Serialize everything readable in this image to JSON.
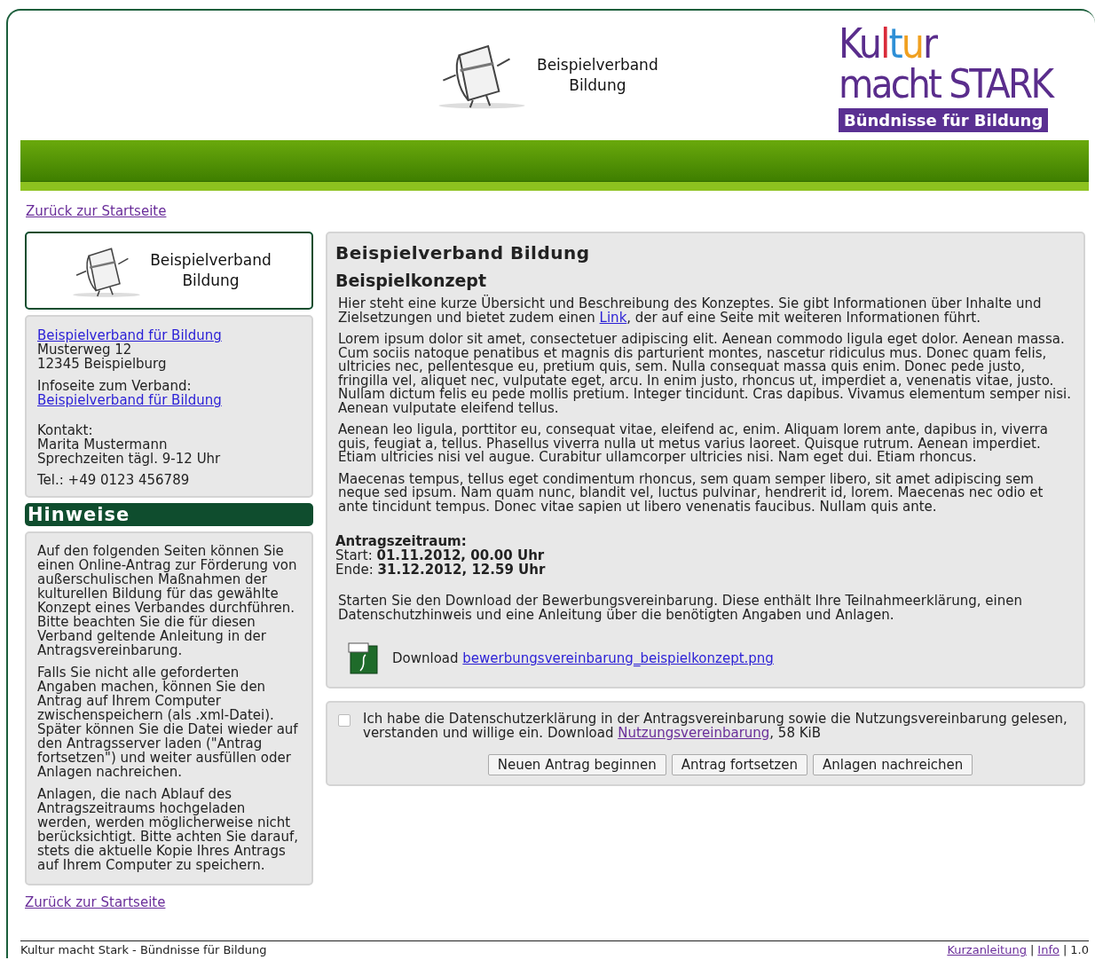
{
  "header": {
    "org_name": [
      "Beispielverband",
      "Bildung"
    ],
    "logo": {
      "word": "Kultur",
      "line2": "macht STARK",
      "banner": "Bündnisse für Bildung"
    }
  },
  "back_link_top": "Zurück zur Startseite",
  "sidebar": {
    "org_card": [
      "Beispielverband",
      "Bildung"
    ],
    "address": {
      "link": "Beispielverband für Bildung",
      "lines": [
        "Musterweg 12",
        "12345 Beispielburg"
      ],
      "info_label": "Infoseite zum Verband:",
      "info_link": "Beispielverband für Bildung",
      "contact": [
        "Kontakt:",
        "Marita Mustermann",
        "Sprechzeiten tägl. 9-12 Uhr"
      ],
      "phone": "Tel.: +49 0123 456789"
    },
    "notes_title": "Hinweise",
    "notes": [
      "Auf den folgenden Seiten können Sie einen Online-Antrag zur Förderung von außerschulischen Maßnahmen der kulturellen Bildung für das gewählte Konzept eines Verbandes durchführen. Bitte beachten Sie die für diesen Verband geltende Anleitung in der Antragsvereinbarung.",
      "Falls Sie nicht alle geforderten Angaben machen, können Sie den Antrag auf Ihrem Computer zwischenspeichern (als .xml-Datei). Später können Sie die Datei wieder auf den Antragsserver laden (\"Antrag fortsetzen\") und weiter ausfüllen oder Anlagen nachreichen.",
      "Anlagen, die nach Ablauf des Antragszeitraums hochgeladen werden, werden möglicherweise nicht berücksichtigt. Bitte achten Sie darauf, stets die aktuelle Kopie Ihres Antrags auf Ihrem Computer zu speichern."
    ]
  },
  "back_link_bottom": "Zurück zur Startseite",
  "main": {
    "title": "Beispielverband Bildung",
    "subtitle": "Beispielkonzept",
    "intro": {
      "before": "Hier steht eine kurze Übersicht und Beschreibung des Konzeptes. Sie gibt Informationen über Inhalte und Zielsetzungen und bietet zudem einen",
      "link": "Link",
      "after": ", der auf eine Seite mit weiteren Informationen führt."
    },
    "paragraphs": [
      "Lorem ipsum dolor sit amet, consectetuer adipiscing elit. Aenean commodo ligula eget dolor. Aenean massa. Cum sociis natoque penatibus et magnis dis parturient montes, nascetur ridiculus mus. Donec quam felis, ultricies nec, pellentesque eu, pretium quis, sem. Nulla consequat massa quis enim. Donec pede justo, fringilla vel, aliquet nec, vulputate eget, arcu. In enim justo, rhoncus ut, imperdiet a, venenatis vitae, justo. Nullam dictum felis eu pede mollis pretium. Integer tincidunt. Cras dapibus. Vivamus elementum semper nisi. Aenean vulputate eleifend tellus.",
      "Aenean leo ligula, porttitor eu, consequat vitae, eleifend ac, enim. Aliquam lorem ante, dapibus in, viverra quis, feugiat a, tellus. Phasellus viverra nulla ut metus varius laoreet. Quisque rutrum. Aenean imperdiet. Etiam ultricies nisi vel augue. Curabitur ullamcorper ultricies nisi. Nam eget dui. Etiam rhoncus.",
      "Maecenas tempus, tellus eget condimentum rhoncus, sem quam semper libero, sit amet adipiscing sem neque sed ipsum. Nam quam nunc, blandit vel, luctus pulvinar, hendrerit id, lorem. Maecenas nec odio et ante tincidunt tempus. Donec vitae sapien ut libero venenatis faucibus. Nullam quis ante."
    ],
    "period_title": "Antragszeitraum:",
    "period": [
      "Start: **01.11.2012, 00.00 Uhr**",
      "Ende: **31.12.2012, 12.59 Uhr**"
    ],
    "download_text": "Starten Sie den Download der Bewerbungsvereinbarung. Diese enthält Ihre Teilnahmeerklärung, einen Datenschutzhinweis und eine Anleitung über die benötigten Angaben und Anlagen.",
    "download": {
      "label": "Download",
      "link": "bewerbungsvereinbarung_beispielkonzept.png"
    }
  },
  "consent": {
    "checked": false,
    "before": "Ich habe die Datenschutzerklärung in der Antragsvereinbarung sowie die Nutzungsvereinbarung gelesen, verstanden und willige ein. Download",
    "link": "Nutzungsvereinbarung",
    "after": ", 58 KiB"
  },
  "buttons": [
    "Neuen Antrag beginnen",
    "Antrag fortsetzen",
    "Anlagen nachreichen"
  ],
  "footer": {
    "text": "Kultur macht Stark - Bündnisse für Bildung",
    "links": [
      "Kurzanleitung",
      "Info"
    ],
    "separator": "|",
    "version": "1.0"
  }
}
